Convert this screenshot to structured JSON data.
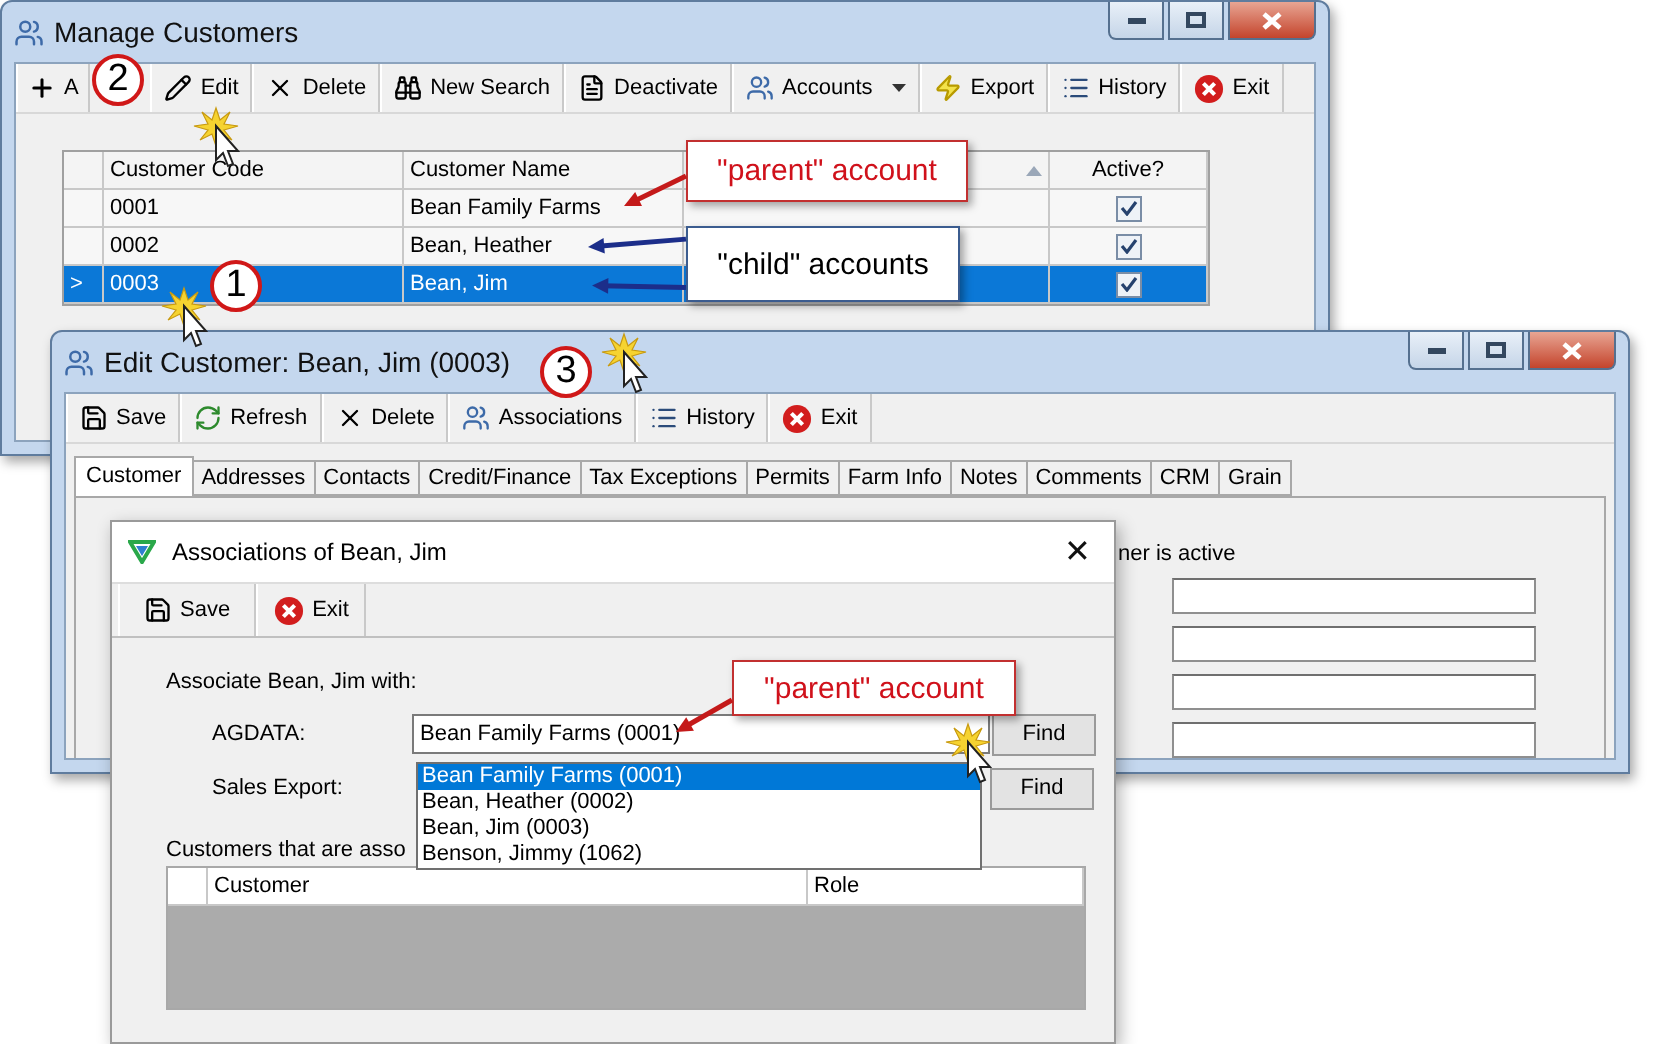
{
  "manage_window": {
    "title": "Manage Customers",
    "toolbar": [
      {
        "label": "A"
      },
      {
        "label": "Edit"
      },
      {
        "label": "Delete"
      },
      {
        "label": "New Search"
      },
      {
        "label": "Deactivate"
      },
      {
        "label": "Accounts"
      },
      {
        "label": "Export"
      },
      {
        "label": "History"
      },
      {
        "label": "Exit"
      }
    ],
    "table": {
      "columns": [
        {
          "kind": "text",
          "label": "Customer Code"
        },
        {
          "kind": "text",
          "label": "Customer Name"
        },
        {
          "kind": "sort"
        },
        {
          "kind": "text",
          "label": "Active?"
        }
      ],
      "rows": [
        {
          "code": "0001",
          "name": "Bean Family Farms",
          "active": true,
          "selected": false
        },
        {
          "code": "0002",
          "name": "Bean, Heather",
          "active": true,
          "selected": false
        },
        {
          "marker": ">",
          "code": "0003",
          "name": "Bean, Jim",
          "active": true,
          "selected": true
        }
      ]
    }
  },
  "edit_window": {
    "title": "Edit Customer: Bean, Jim (0003)",
    "toolbar": [
      {
        "label": "Save"
      },
      {
        "label": "Refresh"
      },
      {
        "label": "Delete"
      },
      {
        "label": "Associations"
      },
      {
        "label": "History"
      },
      {
        "label": "Exit"
      }
    ],
    "tabs": [
      {
        "label": "Customer",
        "selected": true
      },
      {
        "label": "Addresses",
        "selected": false
      },
      {
        "label": "Contacts",
        "selected": false
      },
      {
        "label": "Credit/Finance",
        "selected": false
      },
      {
        "label": "Tax Exceptions",
        "selected": false
      },
      {
        "label": "Permits",
        "selected": false
      },
      {
        "label": "Farm Info",
        "selected": false
      },
      {
        "label": "Notes",
        "selected": false
      },
      {
        "label": "Comments",
        "selected": false
      },
      {
        "label": "CRM",
        "selected": false
      },
      {
        "label": "Grain",
        "selected": false
      }
    ],
    "active_label": "ner is active"
  },
  "dialog": {
    "title": "Associations of Bean, Jim",
    "close": "✕",
    "toolbar": [
      {
        "label": "Save"
      },
      {
        "label": "Exit"
      }
    ],
    "intro": "Associate Bean, Jim with:",
    "fields": [
      {
        "label": "AGDATA:",
        "value": "Bean Family Farms (0001)",
        "button": "Find"
      },
      {
        "label": "Sales Export:",
        "button": "Find"
      }
    ],
    "dropdown_options": [
      {
        "label": "Bean Family Farms (0001)",
        "selected": true
      },
      {
        "label": "Bean, Heather (0002)",
        "selected": false
      },
      {
        "label": "Bean, Jim (0003)",
        "selected": false
      },
      {
        "label": "Benson, Jimmy (1062)",
        "selected": false
      }
    ],
    "grid_label": "Customers that are asso",
    "grid_columns": [
      "Customer",
      "Role"
    ]
  },
  "callouts": [
    {
      "text": "\"parent\" account",
      "color": "#d0111b"
    },
    {
      "text": "\"child\" accounts",
      "color": "#000000"
    },
    {
      "text": "\"parent\" account",
      "color": "#d0111b"
    }
  ],
  "steps": [
    "1",
    "2",
    "3"
  ]
}
